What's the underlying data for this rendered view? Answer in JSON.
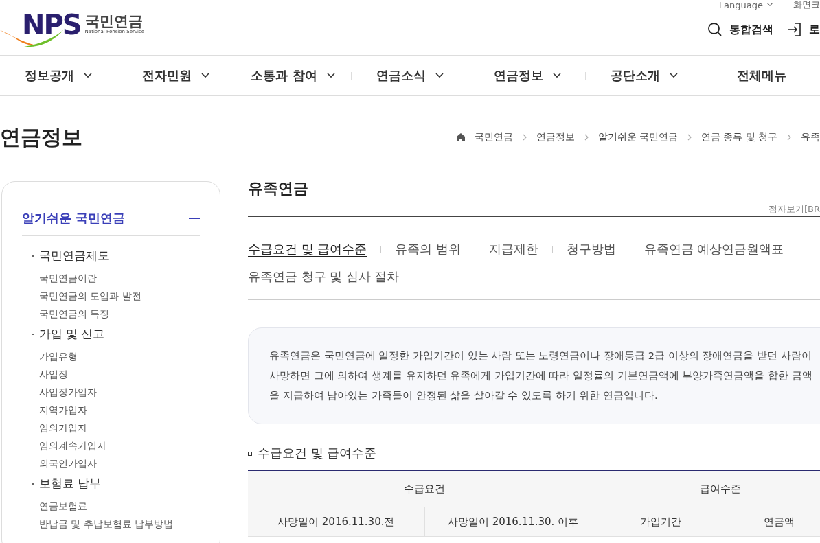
{
  "header": {
    "logo": {
      "initials": "NPS",
      "name": "국민연금",
      "subtitle": "National Pension Service"
    },
    "utility_links": [
      {
        "label": "Language",
        "kind": "dropdown"
      },
      {
        "label": "화면크",
        "kind": "link"
      }
    ],
    "actions": [
      {
        "label": "통합검색",
        "kind": "search"
      },
      {
        "label": "로",
        "kind": "login"
      }
    ]
  },
  "nav": [
    {
      "label": "정보공개",
      "has_menu": true
    },
    {
      "label": "전자민원",
      "has_menu": true
    },
    {
      "label": "소통과 참여",
      "has_menu": true
    },
    {
      "label": "연금소식",
      "has_menu": true
    },
    {
      "label": "연금정보",
      "has_menu": true
    },
    {
      "label": "공단소개",
      "has_menu": true
    },
    {
      "label": "전체메뉴",
      "has_menu": false
    }
  ],
  "page_title": "연금정보",
  "breadcrumb": [
    "국민연금",
    "연금정보",
    "알기쉬운 국민연금",
    "연금 종류 및 청구",
    "유족"
  ],
  "sidebar": {
    "title": "알기쉬운 국민연금",
    "expanded": true,
    "groups": [
      {
        "label": "국민연금제도",
        "items": [
          "국민연금이란",
          "국민연금의 도입과 발전",
          "국민연금의 특징"
        ]
      },
      {
        "label": "가입 및 신고",
        "items": [
          "가입유형",
          "사업장",
          "사업장가입자",
          "지역가입자",
          "임의가입자",
          "임의계속가입자",
          "외국인가입자"
        ]
      },
      {
        "label": "보험료 납부",
        "items": [
          "연금보험료",
          "반납금 및 추납보험료 납부방법"
        ]
      }
    ]
  },
  "content": {
    "title": "유족연금",
    "braille_link": "점자보기[BR",
    "tabs": [
      {
        "label": "수급요건 및 급여수준",
        "selected": true
      },
      {
        "label": "유족의 범위",
        "selected": false
      },
      {
        "label": "지급제한",
        "selected": false
      },
      {
        "label": "청구방법",
        "selected": false
      },
      {
        "label": "유족연금 예상연금월액표",
        "selected": false
      },
      {
        "label": "유족연금 청구 및 심사 절차",
        "selected": false
      }
    ],
    "summary": "유족연금은 국민연금에 일정한 가입기간이 있는 사람 또는 노령연금이나 장애등급 2급 이상의 장애연금을 받던 사람이 사망하면 그에 의하여 생계를 유지하던 유족에게 가입기간에 따라 일정률의 기본연금액에 부양가족연금액을 합한 금액을 지급하여 남아있는 가족들이 안정된 삶을 살아갈 수 있도록 하기 위한 연금입니다.",
    "section_title": "수급요건 및 급여수준",
    "table": {
      "header_groups": [
        {
          "label": "수급요건",
          "columns": [
            "사망일이 2016.11.30.전",
            "사망일이 2016.11.30. 이후"
          ]
        },
        {
          "label": "급여수준",
          "columns": [
            "가입기간",
            "연금액"
          ]
        }
      ]
    }
  }
}
